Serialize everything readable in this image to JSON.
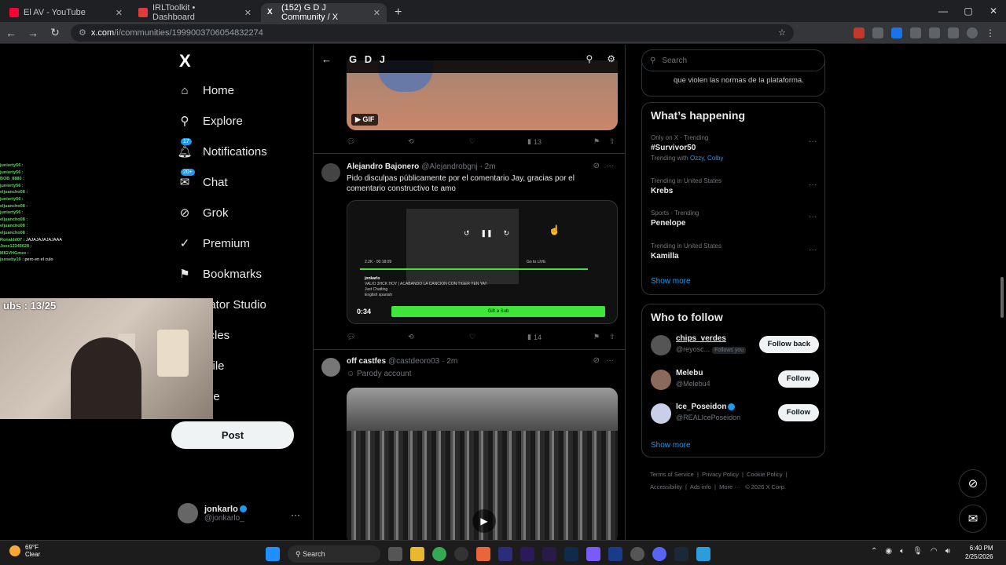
{
  "browser": {
    "tabs": [
      {
        "title": "El AV - YouTube",
        "color": "#ff0033"
      },
      {
        "title": "IRLToolkit • Dashboard",
        "color": "#e03a3a"
      },
      {
        "title": "(152) G D J Community / X",
        "color": "#ffffff",
        "active": true
      }
    ],
    "url_host": "x.com",
    "url_path": "/i/communities/1999003706054832274",
    "new_tab": "+"
  },
  "nav": {
    "logo": "X",
    "items": [
      {
        "label": "Home",
        "icon": "home-icon"
      },
      {
        "label": "Explore",
        "icon": "search-icon"
      },
      {
        "label": "Notifications",
        "icon": "bell-icon",
        "badge": "17"
      },
      {
        "label": "Chat",
        "icon": "chat-icon",
        "badge": "20+"
      },
      {
        "label": "Grok",
        "icon": "grok-icon"
      },
      {
        "label": "Premium",
        "icon": "premium-icon"
      },
      {
        "label": "Bookmarks",
        "icon": "bookmark-icon"
      },
      {
        "label": "eator Studio",
        "icon": "studio-icon"
      },
      {
        "label": "ticles",
        "icon": "articles-icon"
      },
      {
        "label": "ofile",
        "icon": "profile-icon"
      },
      {
        "label": "ore",
        "icon": "more-icon"
      }
    ],
    "post_label": "Post",
    "account_name": "jonkarlo",
    "account_handle": "@jonkarlo_"
  },
  "stream_overlay": {
    "subs": "ubs : 13/25",
    "chat": [
      {
        "user": "juniorty56 :",
        "msg": ""
      },
      {
        "user": "juniorty56 :",
        "msg": ""
      },
      {
        "user": "BOB_8880 :",
        "msg": ""
      },
      {
        "user": "juniorty56 :",
        "msg": ""
      },
      {
        "user": "eljuancho08 :",
        "msg": ""
      },
      {
        "user": "juniorty56 :",
        "msg": ""
      },
      {
        "user": "eljuancho08 :",
        "msg": ""
      },
      {
        "user": "juniorty56 :",
        "msg": ""
      },
      {
        "user": "eljuancho08 :",
        "msg": ""
      },
      {
        "user": "eljuancho08 :",
        "msg": ""
      },
      {
        "user": "eljuancho08 :",
        "msg": ""
      },
      {
        "user": "Ronaldd07 :",
        "msg": "JAJAJAJAJAJAAA"
      },
      {
        "user": "Jose12345628 :",
        "msg": ""
      },
      {
        "user": "MIGVHGmex :",
        "msg": ""
      },
      {
        "user": "jsoseby19 :",
        "msg": "pero en el culo"
      }
    ]
  },
  "community": {
    "title": "G D J",
    "gif_label": "GIF",
    "tweet1_views": "13",
    "tweet2": {
      "name": "Alejandro Bajonero",
      "handle": "@Alejandrobgnj",
      "time": "· 2m",
      "text": "Pido disculpas públicamente por el comentario Jay, gracias por el comentario constructivo te amo",
      "video_time": "0:34",
      "video_stream_title": "VALIO 3HCK HOY | ACABANDO LA CANCION CON TIGER YEN YA!!",
      "video_channel": "jonkarlo",
      "video_sub": "Just Chatting",
      "video_tags": "English   spanish",
      "video_viewers": "2.2K",
      "video_elapsed": "00:18:09",
      "video_golive": "Go to LIVE",
      "video_gift": "Gift a Sub",
      "views": "14"
    },
    "tweet3": {
      "name": "off castfes",
      "handle": "@castdeoro03",
      "time": "· 2m",
      "label": "Parody account"
    }
  },
  "sidebar": {
    "search_placeholder": "Search",
    "rules_text": "que violen las normas de la plataforma.",
    "happening_title": "What’s happening",
    "trends": [
      {
        "context": "Only on X · Trending",
        "title": "#Survivor50",
        "with_label": "Trending with",
        "with": "Ozzy, Colby"
      },
      {
        "context": "Trending in United States",
        "title": "Krebs"
      },
      {
        "context": "Sports · Trending",
        "title": "Penelope"
      },
      {
        "context": "Trending in United States",
        "title": "Kamilla"
      }
    ],
    "show_more": "Show more",
    "follow_title": "Who to follow",
    "follow": [
      {
        "name": "chips_verdes",
        "handle": "@reyosc...",
        "follows_you": "Follows you",
        "button": "Follow back"
      },
      {
        "name": "Melebu",
        "handle": "@Melebu4",
        "button": "Follow"
      },
      {
        "name": "Ice_Poseidon",
        "handle": "@REALIcePoseidon",
        "button": "Follow",
        "verified": true
      }
    ],
    "footer": [
      "Terms of Service",
      "Privacy Policy",
      "Cookie Policy",
      "Accessibility",
      "Ads info",
      "More ···",
      "© 2026 X Corp."
    ]
  },
  "taskbar": {
    "temp": "69°F",
    "weather": "Clear",
    "search": "Search",
    "time": "6:40 PM",
    "date": "2/25/2026"
  },
  "colors": {
    "accent": "#1d9bf0",
    "bg": "#000000",
    "border": "#2f3336",
    "stream_green": "#3ee63a"
  }
}
